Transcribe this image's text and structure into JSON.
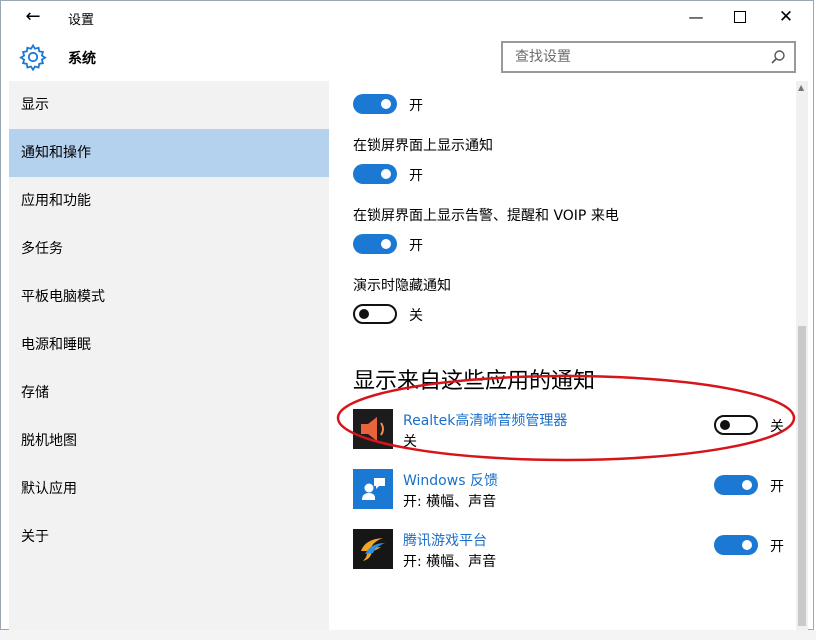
{
  "window": {
    "title": "设置",
    "back_icon": "arrow-left-icon",
    "controls": [
      "minimize-icon",
      "maximize-icon",
      "close-icon"
    ]
  },
  "header": {
    "icon": "gear-icon",
    "title": "系统",
    "search_placeholder": "查找设置"
  },
  "sidebar": {
    "items": [
      {
        "label": "显示"
      },
      {
        "label": "通知和操作",
        "active": true
      },
      {
        "label": "应用和功能"
      },
      {
        "label": "多任务"
      },
      {
        "label": "平板电脑模式"
      },
      {
        "label": "电源和睡眠"
      },
      {
        "label": "存储"
      },
      {
        "label": "脱机地图"
      },
      {
        "label": "默认应用"
      },
      {
        "label": "关于"
      }
    ]
  },
  "main": {
    "settings": [
      {
        "label": "",
        "state": "开",
        "on": true
      },
      {
        "label": "在锁屏界面上显示通知",
        "state": "开",
        "on": true
      },
      {
        "label": "在锁屏界面上显示告警、提醒和 VOIP 来电",
        "state": "开",
        "on": true
      },
      {
        "label": "演示时隐藏通知",
        "state": "关",
        "on": false
      }
    ],
    "section_title": "显示来自这些应用的通知",
    "apps": [
      {
        "name": "Realtek高清晰音频管理器",
        "sub": "关",
        "state": "关",
        "on": false,
        "icon": "speaker-icon"
      },
      {
        "name": "Windows 反馈",
        "sub": "开: 横幅、声音",
        "state": "开",
        "on": true,
        "icon": "feedback-icon"
      },
      {
        "name": "腾讯游戏平台",
        "sub": "开: 横幅、声音",
        "state": "开",
        "on": true,
        "icon": "tencent-games-icon"
      }
    ]
  },
  "colors": {
    "accent": "#1b79d3",
    "sidebar_bg": "#f2f2f2",
    "active_item": "#b4d2ee",
    "link": "#1a6fc9",
    "annotation": "#d6151b"
  }
}
